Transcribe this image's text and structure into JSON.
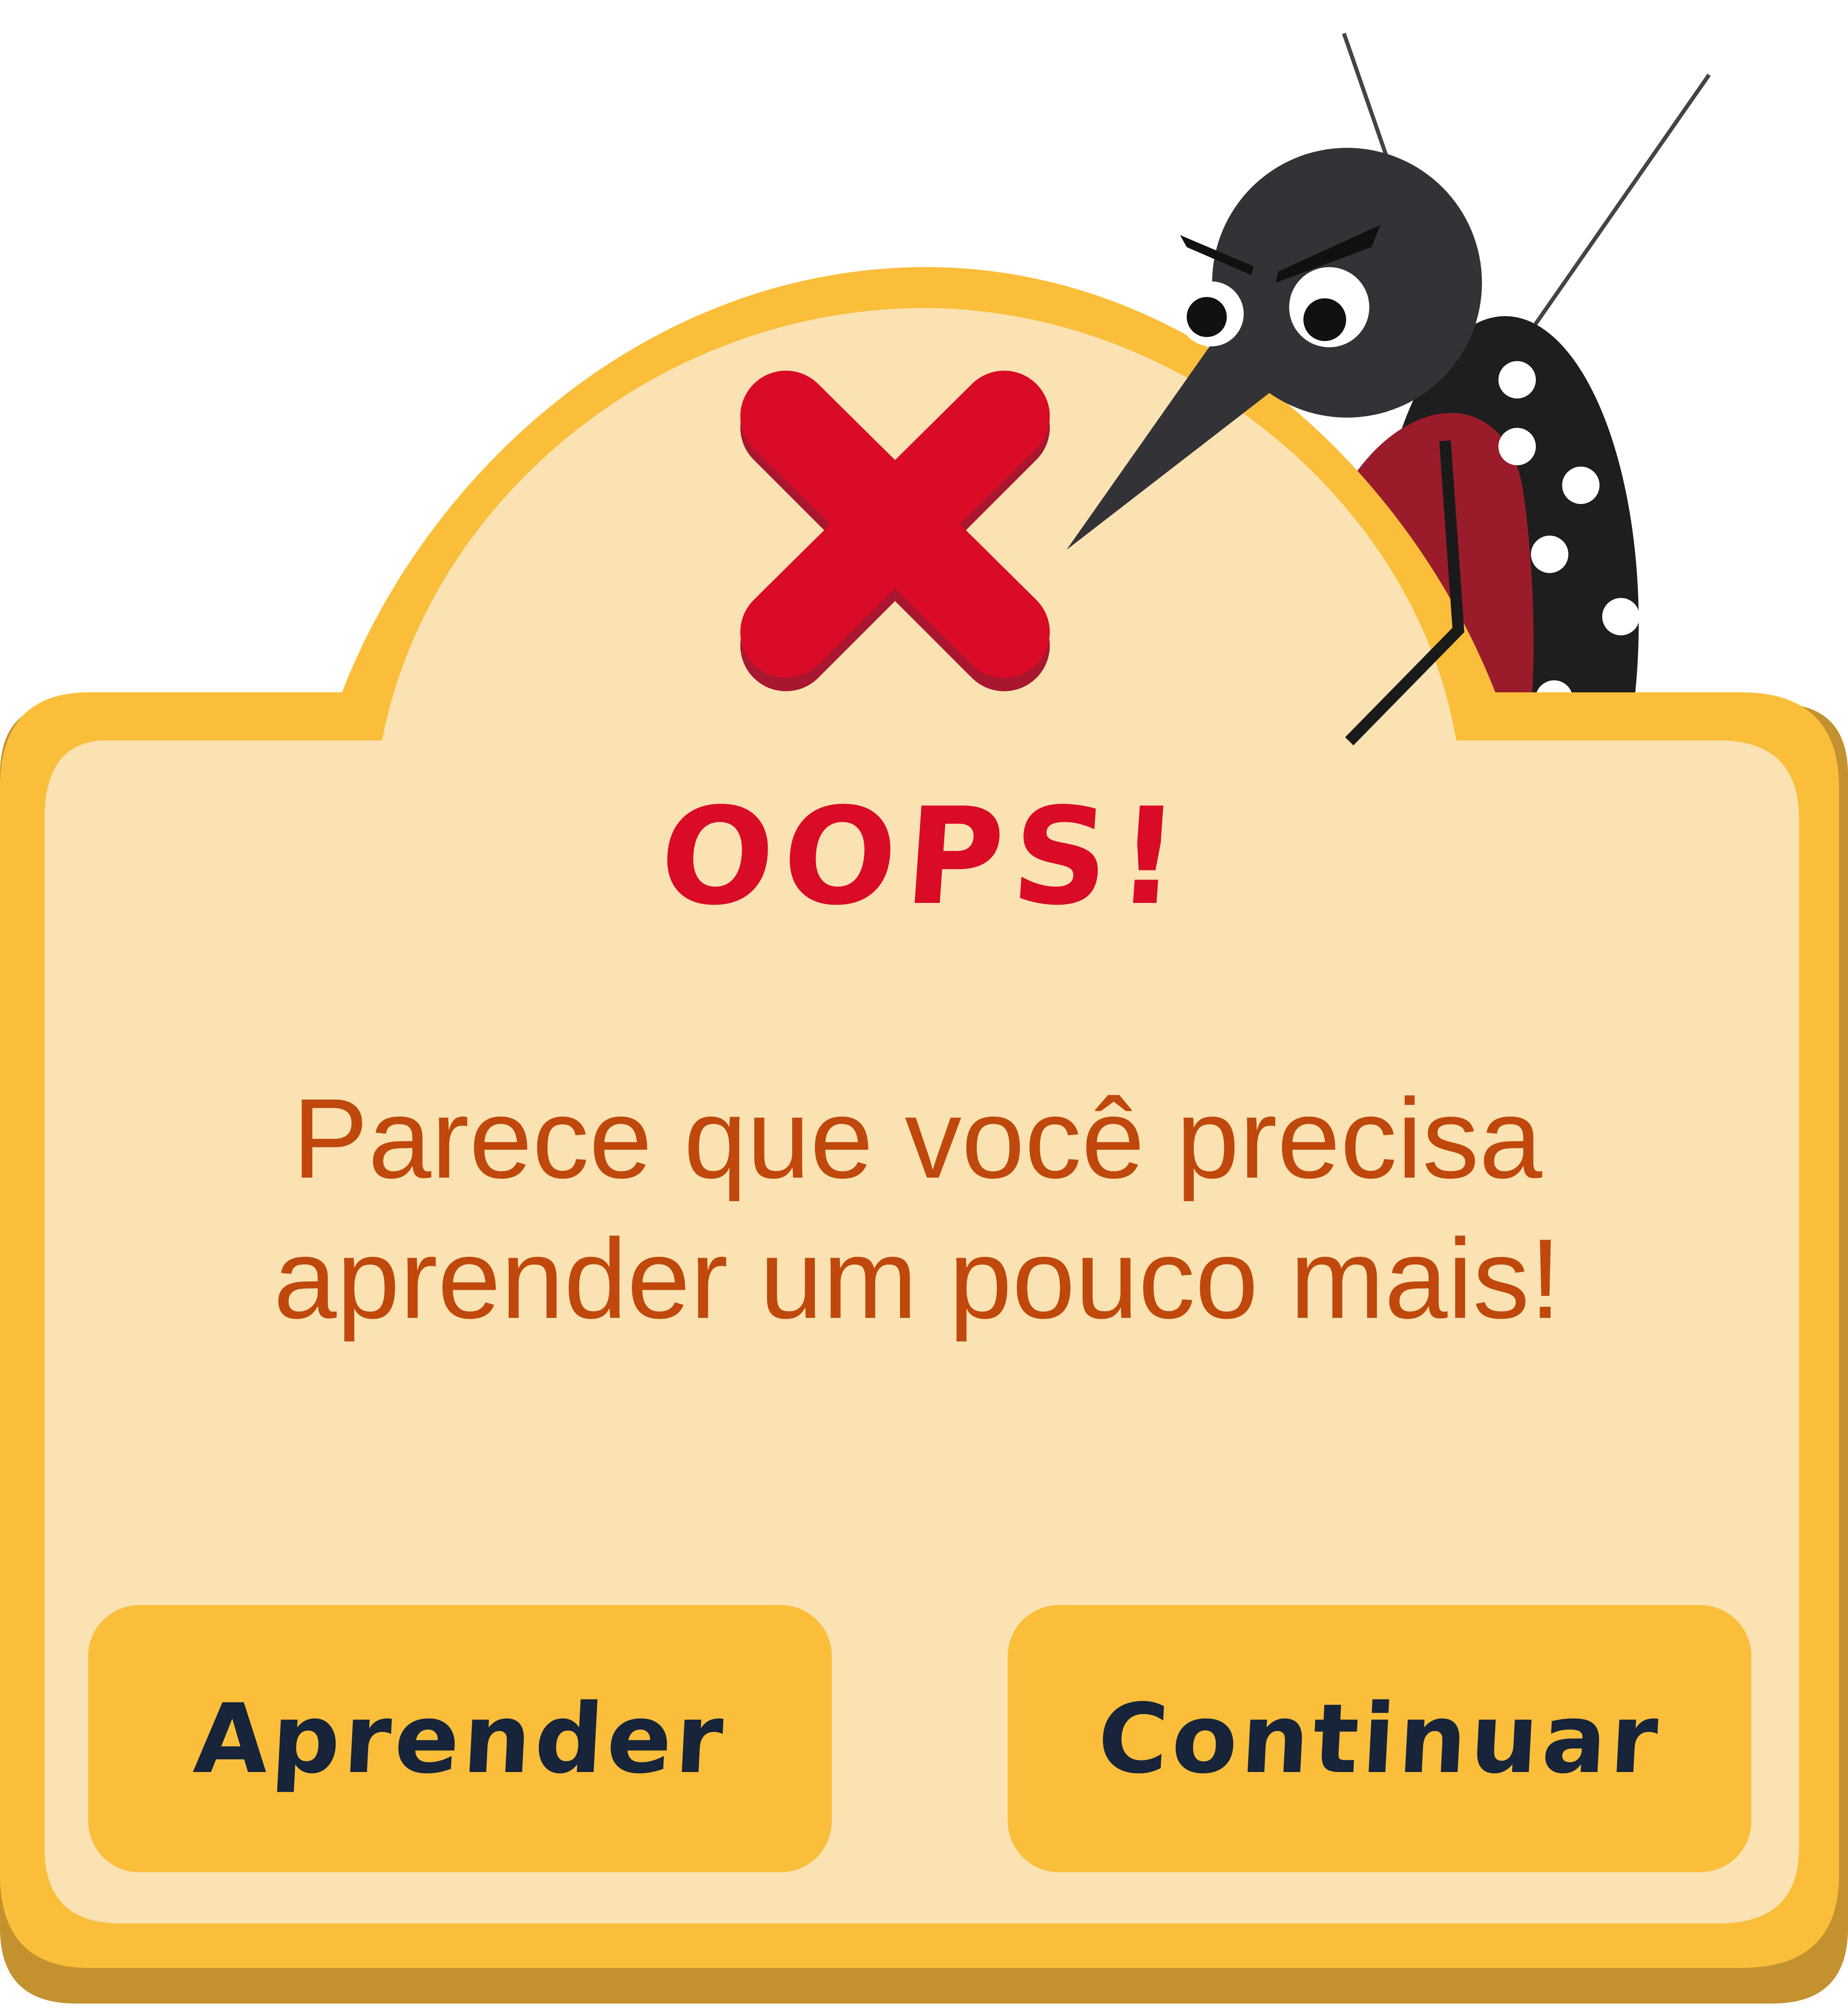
{
  "dialog": {
    "title": "OOPS!",
    "message_lines": [
      "Parece que você precisa",
      "aprender um pouco mais!"
    ],
    "status_icon": "x-mark-icon",
    "mascot": "mosquito-mascot"
  },
  "buttons": {
    "learn_label": "Aprender",
    "continue_label": "Continuar"
  },
  "colors": {
    "panel_fill": "#fbe2b2",
    "panel_border": "#fbbe3a",
    "panel_shadow": "#c4912f",
    "title": "#d90b26",
    "message": "#c0480c",
    "button_fill": "#fbbe3a",
    "button_text": "#17243a",
    "x_mark": "#d90b26",
    "x_mark_shadow": "#a8162f"
  }
}
